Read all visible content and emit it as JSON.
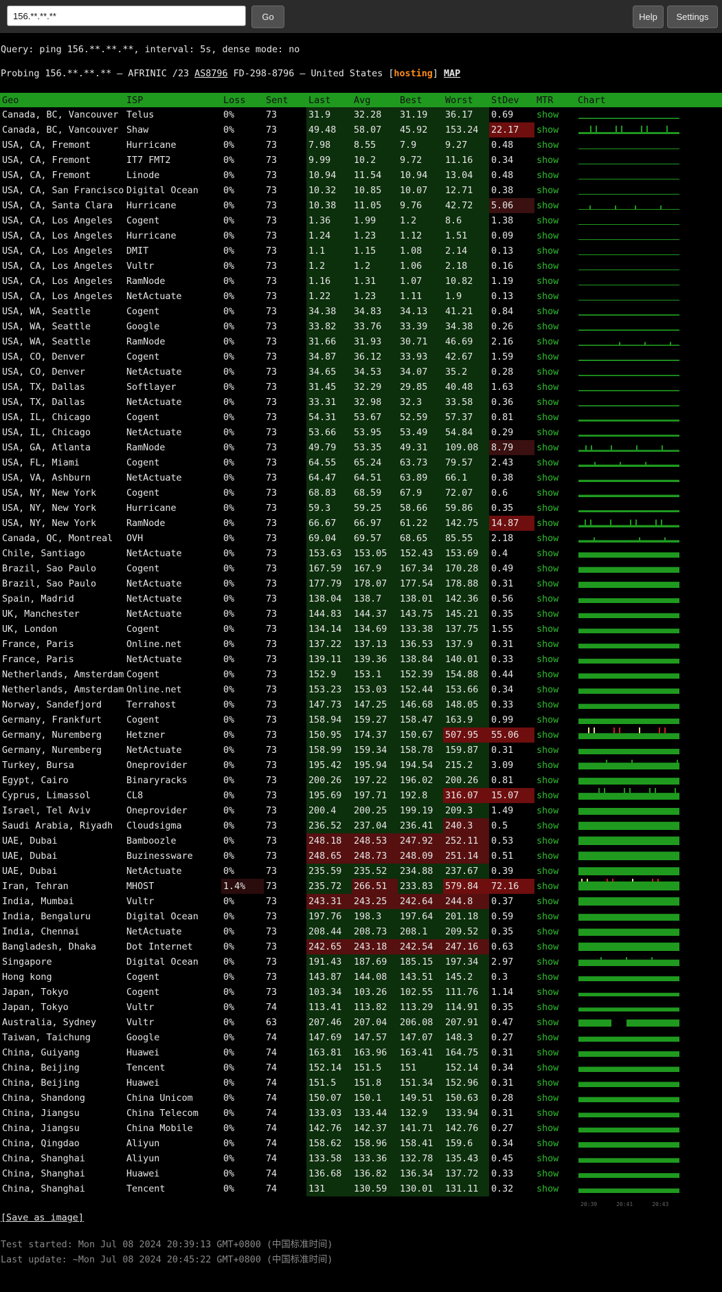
{
  "search": {
    "value": "156.**.**.**",
    "go_label": "Go"
  },
  "toolbar": {
    "help_label": "Help",
    "settings_label": "Settings"
  },
  "query_line": "Query: ping 156.**.**.**, interval: 5s, dense mode: no",
  "probe_line": {
    "prefix": "Probing 156.**.**.** – AFRINIC /23 ",
    "asn": "AS8796",
    "middle": " FD-298-8796 – United States [",
    "tag": "hosting",
    "suffix": "] ",
    "map": "MAP"
  },
  "headers": [
    "Geo",
    "ISP",
    "Loss",
    "Sent",
    "Last",
    "Avg",
    "Best",
    "Worst",
    "StDev",
    "MTR",
    "Chart"
  ],
  "mtr_label": "show",
  "rows": [
    [
      "Canada, BC, Vancouver",
      "Telus",
      "0%",
      "73",
      "31.9",
      "32.28",
      "31.19",
      "36.17",
      "0.69"
    ],
    [
      "Canada, BC, Vancouver",
      "Shaw",
      "0%",
      "73",
      "49.48",
      "58.07",
      "45.92",
      "153.24",
      "22.17"
    ],
    [
      "USA, CA, Fremont",
      "Hurricane",
      "0%",
      "73",
      "7.98",
      "8.55",
      "7.9",
      "9.27",
      "0.48"
    ],
    [
      "USA, CA, Fremont",
      "IT7 FMT2",
      "0%",
      "73",
      "9.99",
      "10.2",
      "9.72",
      "11.16",
      "0.34"
    ],
    [
      "USA, CA, Fremont",
      "Linode",
      "0%",
      "73",
      "10.94",
      "11.54",
      "10.94",
      "13.04",
      "0.48"
    ],
    [
      "USA, CA, San Francisco",
      "Digital Ocean",
      "0%",
      "73",
      "10.32",
      "10.85",
      "10.07",
      "12.71",
      "0.38"
    ],
    [
      "USA, CA, Santa Clara",
      "Hurricane",
      "0%",
      "73",
      "10.38",
      "11.05",
      "9.76",
      "42.72",
      "5.06"
    ],
    [
      "USA, CA, Los Angeles",
      "Cogent",
      "0%",
      "73",
      "1.36",
      "1.99",
      "1.2",
      "8.6",
      "1.38"
    ],
    [
      "USA, CA, Los Angeles",
      "Hurricane",
      "0%",
      "73",
      "1.24",
      "1.23",
      "1.12",
      "1.51",
      "0.09"
    ],
    [
      "USA, CA, Los Angeles",
      "DMIT",
      "0%",
      "73",
      "1.1",
      "1.15",
      "1.08",
      "2.14",
      "0.13"
    ],
    [
      "USA, CA, Los Angeles",
      "Vultr",
      "0%",
      "73",
      "1.2",
      "1.2",
      "1.06",
      "2.18",
      "0.16"
    ],
    [
      "USA, CA, Los Angeles",
      "RamNode",
      "0%",
      "73",
      "1.16",
      "1.31",
      "1.07",
      "10.82",
      "1.19"
    ],
    [
      "USA, CA, Los Angeles",
      "NetActuate",
      "0%",
      "73",
      "1.22",
      "1.23",
      "1.11",
      "1.9",
      "0.13"
    ],
    [
      "USA, WA, Seattle",
      "Cogent",
      "0%",
      "73",
      "34.38",
      "34.83",
      "34.13",
      "41.21",
      "0.84"
    ],
    [
      "USA, WA, Seattle",
      "Google",
      "0%",
      "73",
      "33.82",
      "33.76",
      "33.39",
      "34.38",
      "0.26"
    ],
    [
      "USA, WA, Seattle",
      "RamNode",
      "0%",
      "73",
      "31.66",
      "31.93",
      "30.71",
      "46.69",
      "2.16"
    ],
    [
      "USA, CO, Denver",
      "Cogent",
      "0%",
      "73",
      "34.87",
      "36.12",
      "33.93",
      "42.67",
      "1.59"
    ],
    [
      "USA, CO, Denver",
      "NetActuate",
      "0%",
      "73",
      "34.65",
      "34.53",
      "34.07",
      "35.2",
      "0.28"
    ],
    [
      "USA, TX, Dallas",
      "Softlayer",
      "0%",
      "73",
      "31.45",
      "32.29",
      "29.85",
      "40.48",
      "1.63"
    ],
    [
      "USA, TX, Dallas",
      "NetActuate",
      "0%",
      "73",
      "33.31",
      "32.98",
      "32.3",
      "33.58",
      "0.36"
    ],
    [
      "USA, IL, Chicago",
      "Cogent",
      "0%",
      "73",
      "54.31",
      "53.67",
      "52.59",
      "57.37",
      "0.81"
    ],
    [
      "USA, IL, Chicago",
      "NetActuate",
      "0%",
      "73",
      "53.66",
      "53.95",
      "53.49",
      "54.84",
      "0.29"
    ],
    [
      "USA, GA, Atlanta",
      "RamNode",
      "0%",
      "73",
      "49.79",
      "53.35",
      "49.31",
      "109.08",
      "8.79"
    ],
    [
      "USA, FL, Miami",
      "Cogent",
      "0%",
      "73",
      "64.55",
      "65.24",
      "63.73",
      "79.57",
      "2.43"
    ],
    [
      "USA, VA, Ashburn",
      "NetActuate",
      "0%",
      "73",
      "64.47",
      "64.51",
      "63.89",
      "66.1",
      "0.38"
    ],
    [
      "USA, NY, New York",
      "Cogent",
      "0%",
      "73",
      "68.83",
      "68.59",
      "67.9",
      "72.07",
      "0.6"
    ],
    [
      "USA, NY, New York",
      "Hurricane",
      "0%",
      "73",
      "59.3",
      "59.25",
      "58.66",
      "59.86",
      "0.35"
    ],
    [
      "USA, NY, New York",
      "RamNode",
      "0%",
      "73",
      "66.67",
      "66.97",
      "61.22",
      "142.75",
      "14.87"
    ],
    [
      "Canada, QC, Montreal",
      "OVH",
      "0%",
      "73",
      "69.04",
      "69.57",
      "68.65",
      "85.55",
      "2.18"
    ],
    [
      "Chile, Santiago",
      "NetActuate",
      "0%",
      "73",
      "153.63",
      "153.05",
      "152.43",
      "153.69",
      "0.4"
    ],
    [
      "Brazil, Sao Paulo",
      "Cogent",
      "0%",
      "73",
      "167.59",
      "167.9",
      "167.34",
      "170.28",
      "0.49"
    ],
    [
      "Brazil, Sao Paulo",
      "NetActuate",
      "0%",
      "73",
      "177.79",
      "178.07",
      "177.54",
      "178.88",
      "0.31"
    ],
    [
      "Spain, Madrid",
      "NetActuate",
      "0%",
      "73",
      "138.04",
      "138.7",
      "138.01",
      "142.36",
      "0.56"
    ],
    [
      "UK, Manchester",
      "NetActuate",
      "0%",
      "73",
      "144.83",
      "144.37",
      "143.75",
      "145.21",
      "0.35"
    ],
    [
      "UK, London",
      "Cogent",
      "0%",
      "73",
      "134.14",
      "134.69",
      "133.38",
      "137.75",
      "1.55"
    ],
    [
      "France, Paris",
      "Online.net",
      "0%",
      "73",
      "137.22",
      "137.13",
      "136.53",
      "137.9",
      "0.31"
    ],
    [
      "France, Paris",
      "NetActuate",
      "0%",
      "73",
      "139.11",
      "139.36",
      "138.84",
      "140.01",
      "0.33"
    ],
    [
      "Netherlands, Amsterdam",
      "Cogent",
      "0%",
      "73",
      "152.9",
      "153.1",
      "152.39",
      "154.88",
      "0.44"
    ],
    [
      "Netherlands, Amsterdam",
      "Online.net",
      "0%",
      "73",
      "153.23",
      "153.03",
      "152.44",
      "153.66",
      "0.34"
    ],
    [
      "Norway, Sandefjord",
      "Terrahost",
      "0%",
      "73",
      "147.73",
      "147.25",
      "146.68",
      "148.05",
      "0.33"
    ],
    [
      "Germany, Frankfurt",
      "Cogent",
      "0%",
      "73",
      "158.94",
      "159.27",
      "158.47",
      "163.9",
      "0.99"
    ],
    [
      "Germany, Nuremberg",
      "Hetzner",
      "0%",
      "73",
      "150.95",
      "174.37",
      "150.67",
      "507.95",
      "55.06"
    ],
    [
      "Germany, Nuremberg",
      "NetActuate",
      "0%",
      "73",
      "158.99",
      "159.34",
      "158.78",
      "159.87",
      "0.31"
    ],
    [
      "Turkey, Bursa",
      "Oneprovider",
      "0%",
      "73",
      "195.42",
      "195.94",
      "194.54",
      "215.2",
      "3.09"
    ],
    [
      "Egypt, Cairo",
      "Binaryracks",
      "0%",
      "73",
      "200.26",
      "197.22",
      "196.02",
      "200.26",
      "0.81"
    ],
    [
      "Cyprus, Limassol",
      "CL8",
      "0%",
      "73",
      "195.69",
      "197.71",
      "192.8",
      "316.07",
      "15.07"
    ],
    [
      "Israel, Tel Aviv",
      "Oneprovider",
      "0%",
      "73",
      "200.4",
      "200.25",
      "199.19",
      "209.3",
      "1.49"
    ],
    [
      "Saudi Arabia, Riyadh",
      "Cloudsigma",
      "0%",
      "73",
      "236.52",
      "237.04",
      "236.41",
      "240.3",
      "0.5"
    ],
    [
      "UAE, Dubai",
      "Bamboozle",
      "0%",
      "73",
      "248.18",
      "248.53",
      "247.92",
      "252.11",
      "0.53"
    ],
    [
      "UAE, Dubai",
      "Buzinessware",
      "0%",
      "73",
      "248.65",
      "248.73",
      "248.09",
      "251.14",
      "0.51"
    ],
    [
      "UAE, Dubai",
      "NetActuate",
      "0%",
      "73",
      "235.59",
      "235.52",
      "234.88",
      "237.67",
      "0.39"
    ],
    [
      "Iran, Tehran",
      "MHOST",
      "1.4%",
      "73",
      "235.72",
      "266.51",
      "233.83",
      "579.84",
      "72.16"
    ],
    [
      "India, Mumbai",
      "Vultr",
      "0%",
      "73",
      "243.31",
      "243.25",
      "242.64",
      "244.8",
      "0.37"
    ],
    [
      "India, Bengaluru",
      "Digital Ocean",
      "0%",
      "73",
      "197.76",
      "198.3",
      "197.64",
      "201.18",
      "0.59"
    ],
    [
      "India, Chennai",
      "NetActuate",
      "0%",
      "73",
      "208.44",
      "208.73",
      "208.1",
      "209.52",
      "0.35"
    ],
    [
      "Bangladesh, Dhaka",
      "Dot Internet",
      "0%",
      "73",
      "242.65",
      "243.18",
      "242.54",
      "247.16",
      "0.63"
    ],
    [
      "Singapore",
      "Digital Ocean",
      "0%",
      "73",
      "191.43",
      "187.69",
      "185.15",
      "197.34",
      "2.97"
    ],
    [
      "Hong kong",
      "Cogent",
      "0%",
      "73",
      "143.87",
      "144.08",
      "143.51",
      "145.2",
      "0.3"
    ],
    [
      "Japan, Tokyo",
      "Cogent",
      "0%",
      "73",
      "103.34",
      "103.26",
      "102.55",
      "111.76",
      "1.14"
    ],
    [
      "Japan, Tokyo",
      "Vultr",
      "0%",
      "74",
      "113.41",
      "113.82",
      "113.29",
      "114.91",
      "0.35"
    ],
    [
      "Australia, Sydney",
      "Vultr",
      "0%",
      "63",
      "207.46",
      "207.04",
      "206.08",
      "207.91",
      "0.47"
    ],
    [
      "Taiwan, Taichung",
      "Google",
      "0%",
      "74",
      "147.69",
      "147.57",
      "147.07",
      "148.3",
      "0.27"
    ],
    [
      "China, Guiyang",
      "Huawei",
      "0%",
      "74",
      "163.81",
      "163.96",
      "163.41",
      "164.75",
      "0.31"
    ],
    [
      "China, Beijing",
      "Tencent",
      "0%",
      "74",
      "152.14",
      "151.5",
      "151",
      "152.14",
      "0.34"
    ],
    [
      "China, Beijing",
      "Huawei",
      "0%",
      "74",
      "151.5",
      "151.8",
      "151.34",
      "152.96",
      "0.31"
    ],
    [
      "China, Shandong",
      "China Unicom",
      "0%",
      "74",
      "150.07",
      "150.1",
      "149.51",
      "150.63",
      "0.28"
    ],
    [
      "China, Jiangsu",
      "China Telecom",
      "0%",
      "74",
      "133.03",
      "133.44",
      "132.9",
      "133.94",
      "0.31"
    ],
    [
      "China, Jiangsu",
      "China Mobile",
      "0%",
      "74",
      "142.76",
      "142.37",
      "141.71",
      "142.76",
      "0.27"
    ],
    [
      "China, Qingdao",
      "Aliyun",
      "0%",
      "74",
      "158.62",
      "158.96",
      "158.41",
      "159.6",
      "0.34"
    ],
    [
      "China, Shanghai",
      "Aliyun",
      "0%",
      "74",
      "133.58",
      "133.36",
      "132.78",
      "135.43",
      "0.45"
    ],
    [
      "China, Shanghai",
      "Huawei",
      "0%",
      "74",
      "136.68",
      "136.82",
      "136.34",
      "137.72",
      "0.33"
    ],
    [
      "China, Shanghai",
      "Tencent",
      "0%",
      "74",
      "131",
      "130.59",
      "130.01",
      "131.11",
      "0.32"
    ]
  ],
  "chart_axis_labels": [
    "20:39",
    "20:41",
    "20:43"
  ],
  "save_label": "[Save as image]",
  "test_started": "Test started: Mon Jul 08 2024 20:39:13 GMT+0800 (中国标准时间)",
  "last_update": "Last update: ~Mon Jul 08 2024 20:45:22 GMT+0800 (中国标准时间)",
  "colors": {
    "header_green": "#1f9a1f",
    "cell_green": "#0c2f0c",
    "alert_red": "#6e0e0e",
    "link_green": "#2fbf2f",
    "hosting_orange": "#ff8c1a"
  }
}
